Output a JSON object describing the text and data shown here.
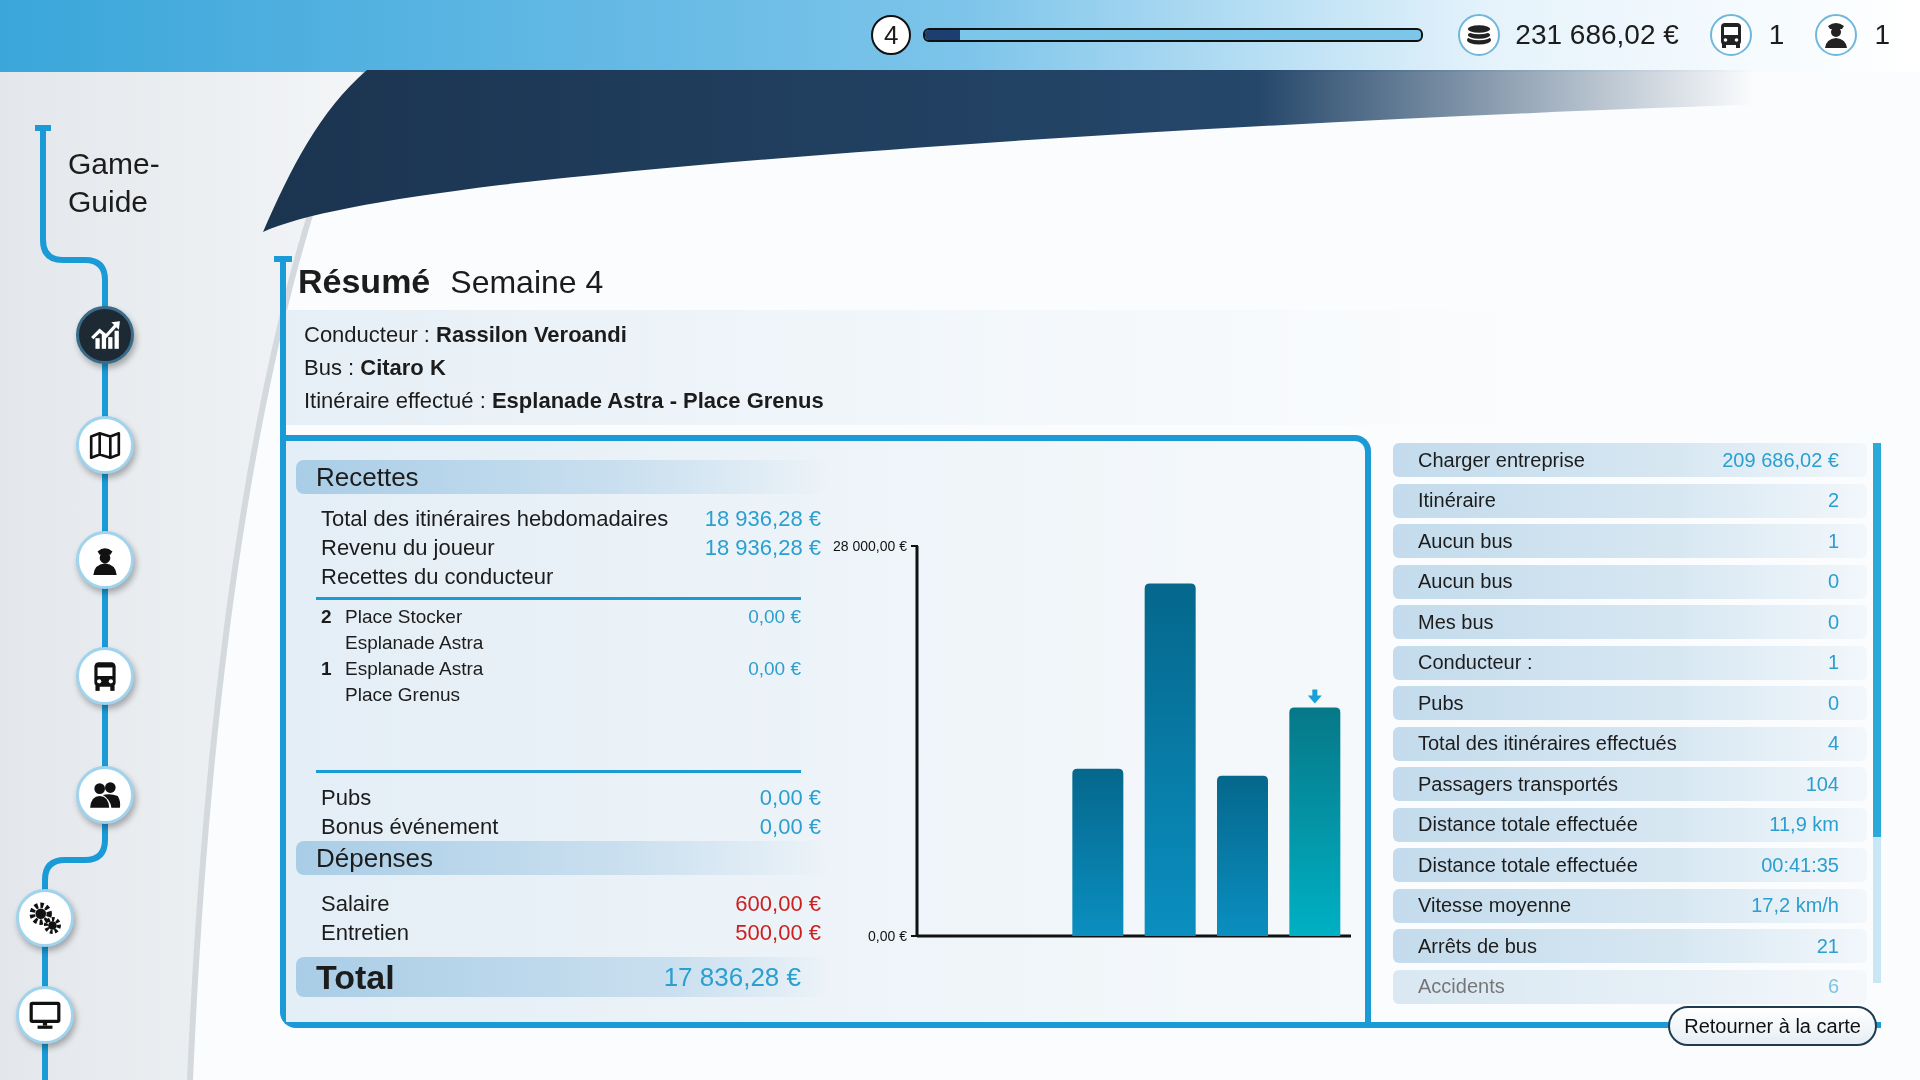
{
  "top_bar": {
    "level": "4",
    "progress": {
      "level": 0.07
    },
    "money": "231 686,02 €",
    "buses": "1",
    "drivers": "1"
  },
  "sidebar": {
    "title": "Game-Guide",
    "items": [
      {
        "kind": "chart",
        "selected": true
      },
      {
        "kind": "map",
        "selected": false
      },
      {
        "kind": "driver",
        "selected": false
      },
      {
        "kind": "bus",
        "selected": false
      },
      {
        "kind": "people",
        "selected": false
      },
      {
        "kind": "gears",
        "selected": false
      },
      {
        "kind": "monitor",
        "selected": false
      }
    ]
  },
  "summary": {
    "title": "Résumé",
    "subtitle": "Semaine 4",
    "info": [
      "Conducteur : **Rassilon Veroandi**",
      "Bus : **Citaro K**",
      "Itinéraire effectué : **Esplanade Astra - Place Grenus**"
    ],
    "income": {
      "title": "Recettes",
      "rows": [
        {
          "label": "Total des itinéraires hebdomadaires",
          "value": "18 936,28 €"
        },
        {
          "label": "Revenu du joueur",
          "value": "18 936,28 €"
        },
        {
          "label": "Recettes du conducteur"
        }
      ],
      "routes": [
        {
          "number": "2",
          "from": "Place Stocker",
          "to": "Esplanade Astra",
          "value": "0,00 €"
        },
        {
          "number": "1",
          "from": "Esplanade Astra",
          "to": "Place Grenus",
          "value": "0,00 €"
        }
      ],
      "extras": [
        {
          "label": "Pubs",
          "value": "0,00 €"
        },
        {
          "label": "Bonus événement",
          "value": "0,00 €"
        }
      ]
    },
    "expenses": {
      "title": "Dépenses",
      "rows": [
        {
          "label": "Salaire",
          "value": "600,00 €"
        },
        {
          "label": "Entretien",
          "value": "500,00 €"
        }
      ]
    },
    "total": {
      "label": "Total",
      "value": "17 836,28 €"
    },
    "chart_data": {
      "type": "bar",
      "values": [
        null,
        null,
        12000,
        25300,
        11500,
        16400
      ],
      "ylim": [
        0,
        28000
      ],
      "yticks": [
        {
          "value": 0,
          "label": "0,00 €"
        },
        {
          "value": 28000,
          "label": "28 000,00 €"
        }
      ]
    },
    "stats": [
      {
        "label": "Charger entreprise",
        "value": "209 686,02 €"
      },
      {
        "label": "Itinéraire",
        "value": "2"
      },
      {
        "label": "Aucun bus",
        "value": "1"
      },
      {
        "label": "Aucun bus",
        "value": "0"
      },
      {
        "label": "Mes bus",
        "value": "0"
      },
      {
        "label": "Conducteur :",
        "value": "1"
      },
      {
        "label": "Pubs",
        "value": "0"
      },
      {
        "label": "Total des itinéraires effectués",
        "value": "4"
      },
      {
        "label": "Passagers transportés",
        "value": "104"
      },
      {
        "label": "Distance totale effectuée",
        "value": "11,9 km"
      },
      {
        "label": "Distance totale effectuée",
        "value": "00:41:35"
      },
      {
        "label": "Vitesse moyenne",
        "value": "17,2 km/h"
      },
      {
        "label": "Arrêts de bus",
        "value": "21"
      },
      {
        "label": "Accidents",
        "value": "6"
      }
    ],
    "button": "Retourner à la carte"
  }
}
